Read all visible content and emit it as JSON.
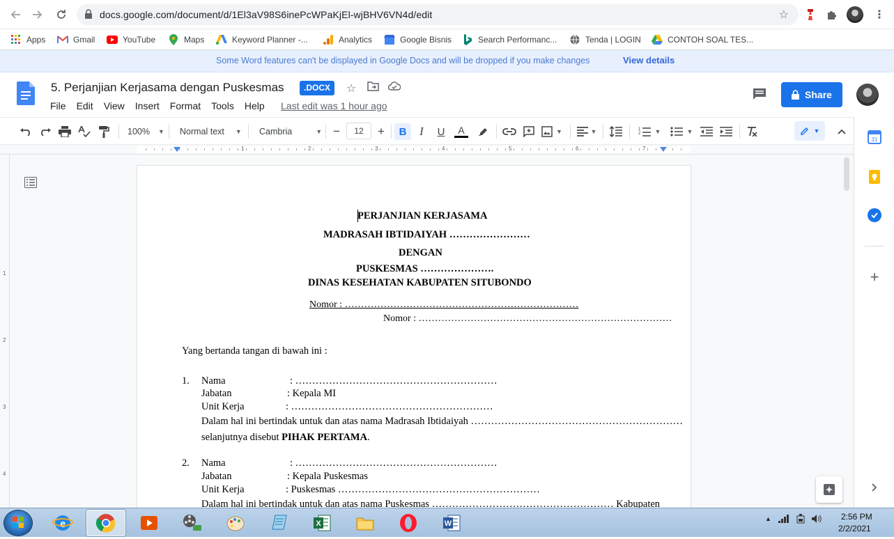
{
  "browser": {
    "url": "docs.google.com/document/d/1El3aV98S6inePcWPaKjEl-wjBHV6VN4d/edit"
  },
  "bookmarks": [
    {
      "label": "Apps",
      "icon": "apps-grid-icon"
    },
    {
      "label": "Gmail",
      "icon": "gmail-icon"
    },
    {
      "label": "YouTube",
      "icon": "youtube-icon"
    },
    {
      "label": "Maps",
      "icon": "maps-icon"
    },
    {
      "label": "Keyword Planner -...",
      "icon": "google-ads-icon"
    },
    {
      "label": "Analytics",
      "icon": "analytics-icon"
    },
    {
      "label": "Google Bisnis",
      "icon": "google-business-icon"
    },
    {
      "label": "Search Performanc...",
      "icon": "bing-icon"
    },
    {
      "label": "Tenda | LOGIN",
      "icon": "globe-icon"
    },
    {
      "label": "CONTOH SOAL TES...",
      "icon": "drive-icon"
    }
  ],
  "banner": {
    "text": "Some Word features can't be displayed in Google Docs and will be dropped if you make changes",
    "link": "View details"
  },
  "doc": {
    "title": "5. Perjanjian Kerjasama dengan Puskesmas",
    "badge": ".DOCX",
    "menu": [
      "File",
      "Edit",
      "View",
      "Insert",
      "Format",
      "Tools",
      "Help"
    ],
    "last_edit": "Last edit was 1 hour ago",
    "share": "Share"
  },
  "toolbar": {
    "zoom": "100%",
    "style": "Normal text",
    "font": "Cambria",
    "font_size": "12"
  },
  "ruler": {
    "numbers": [
      "1",
      "1",
      "2",
      "3",
      "4",
      "5",
      "6",
      "7"
    ],
    "vertical_numbers": [
      "1",
      "2",
      "3",
      "4"
    ]
  },
  "content": {
    "title_lines": [
      "PERJANJIAN KERJASAMA",
      "MADRASAH IBTIDAIYAH ……………………",
      "DENGAN",
      "PUSKESMAS ………………….",
      "DINAS KESEHATAN KABUPATEN SITUBONDO"
    ],
    "nomor1": "Nomor      : ………………………………………………………………",
    "nomor2": "Nomor       : ……………………………………………………………………",
    "intro": "Yang bertanda tangan di bawah ini :",
    "p1": {
      "num": "1.",
      "nama_label": "Nama",
      "nama_value": ": ……………………………………………………",
      "jabatan_label": "Jabatan",
      "jabatan_value": ": Kepala MI",
      "unit_label": "Unit Kerja",
      "unit_value": ": ……………………………………………………",
      "line1": "Dalam hal ini bertindak untuk dan atas nama Madrasah Ibtidaiyah ………………………………………………………",
      "line2_pre": "selanjutnya disebut ",
      "line2_bold": "PIHAK PERTAMA",
      "line2_post": "."
    },
    "p2": {
      "num": "2.",
      "nama_label": "Nama",
      "nama_value": ": ……………………………………………………",
      "jabatan_label": "Jabatan",
      "jabatan_value": ": Kepala Puskesmas",
      "unit_label": "Unit Kerja",
      "unit_value": ": Puskesmas ……………………………………………………",
      "line1": "Dalam hal ini bertindak untuk dan atas nama Puskesmas ……………………………………………… Kabupaten"
    }
  },
  "clock": {
    "time": "2:56 PM",
    "date": "2/2/2021"
  },
  "colors": {
    "accent": "#1a73e8",
    "banner_bg": "#e8f0fe",
    "taskbar": "#a6c2df"
  }
}
